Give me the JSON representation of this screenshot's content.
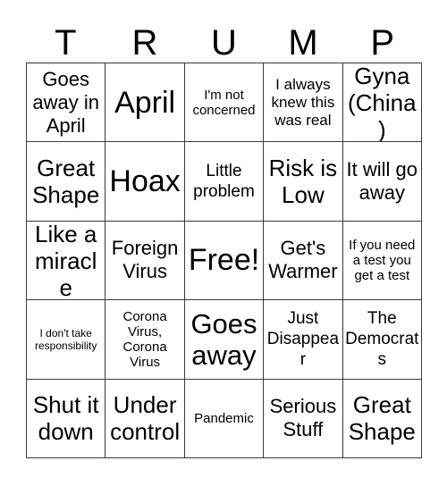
{
  "card": {
    "header_letters": [
      "T",
      "R",
      "U",
      "M",
      "P"
    ],
    "columns": 5,
    "rows": 5,
    "colors": {
      "background": "#ffffff",
      "cell_background": "#ffffff",
      "grid_line": "#3a3a3a",
      "text": "#000000"
    },
    "cells": [
      {
        "text": "Goes away in April",
        "size": "fs-xl",
        "row": 1,
        "col": 1
      },
      {
        "text": "April",
        "size": "fs-4xl",
        "row": 1,
        "col": 2
      },
      {
        "text": "I'm not concerned",
        "size": "fs-s",
        "row": 1,
        "col": 3
      },
      {
        "text": "I always knew this was real",
        "size": "fs-m",
        "row": 1,
        "col": 4
      },
      {
        "text": "Gyna (China)",
        "size": "fs-xxl",
        "row": 1,
        "col": 5
      },
      {
        "text": "Great Shape",
        "size": "fs-xxl",
        "row": 2,
        "col": 1
      },
      {
        "text": "Hoax",
        "size": "fs-4xl",
        "row": 2,
        "col": 2
      },
      {
        "text": "Little problem",
        "size": "fs-l",
        "row": 2,
        "col": 3
      },
      {
        "text": "Risk is Low",
        "size": "fs-xxl",
        "row": 2,
        "col": 4
      },
      {
        "text": "It will go away",
        "size": "fs-xl",
        "row": 2,
        "col": 5
      },
      {
        "text": "Like a miracle",
        "size": "fs-xxl",
        "row": 3,
        "col": 1
      },
      {
        "text": "Foreign Virus",
        "size": "fs-xl",
        "row": 3,
        "col": 2
      },
      {
        "text": "Free!",
        "size": "fs-4xl",
        "row": 3,
        "col": 3
      },
      {
        "text": "Get's Warmer",
        "size": "fs-xl",
        "row": 3,
        "col": 4
      },
      {
        "text": "If you need a test you get a test",
        "size": "fs-s",
        "row": 3,
        "col": 5
      },
      {
        "text": "I don't take responsibility",
        "size": "fs-xxs",
        "row": 4,
        "col": 1
      },
      {
        "text": "Corona Virus, Corona Virus",
        "size": "fs-s",
        "row": 4,
        "col": 2
      },
      {
        "text": "Goes away",
        "size": "fs-3xl",
        "row": 4,
        "col": 3
      },
      {
        "text": "Just Disappear",
        "size": "fs-l",
        "row": 4,
        "col": 4
      },
      {
        "text": "The Democrats",
        "size": "fs-l",
        "row": 4,
        "col": 5
      },
      {
        "text": "Shut it down",
        "size": "fs-xxl",
        "row": 5,
        "col": 1
      },
      {
        "text": "Under control",
        "size": "fs-xxl",
        "row": 5,
        "col": 2
      },
      {
        "text": "Pandemic",
        "size": "fs-s",
        "row": 5,
        "col": 3
      },
      {
        "text": "Serious Stuff",
        "size": "fs-xl",
        "row": 5,
        "col": 4
      },
      {
        "text": "Great Shape",
        "size": "fs-xxl",
        "row": 5,
        "col": 5
      }
    ]
  }
}
